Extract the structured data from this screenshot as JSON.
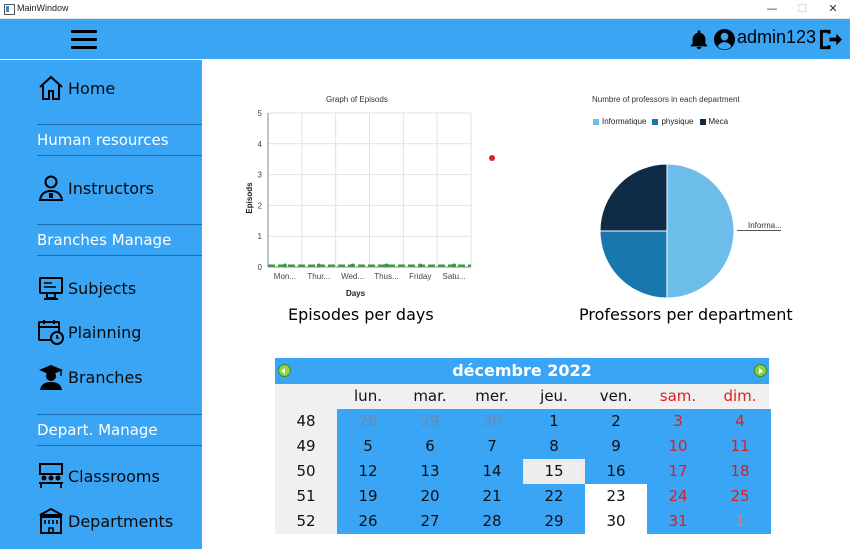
{
  "window": {
    "title": "MainWindow",
    "minimize": "—",
    "maximize": "☐",
    "close": "✕"
  },
  "header": {
    "username": "admin123"
  },
  "sidebar": {
    "home": "Home",
    "section_hr": "Human resources",
    "instructors": "Instructors",
    "section_branches": "Branches Manage",
    "subjects": "Subjects",
    "planning": "Plainning",
    "branches": "Branches",
    "section_depart": "Depart. Manage",
    "classrooms": "Classrooms",
    "departments": "Departments"
  },
  "episodes_caption": "Episodes per days",
  "professors_caption": "Professors per department",
  "chart_data": [
    {
      "type": "line",
      "title": "Graph of Episods",
      "xlabel": "Days",
      "ylabel": "Episods",
      "categories": [
        "Mon...",
        "Thur...",
        "Wed...",
        "Thus...",
        "Friday",
        "Satu..."
      ],
      "ylim": [
        0,
        5
      ],
      "yticks": [
        "0",
        "1",
        "2",
        "3",
        "4",
        "5"
      ],
      "series": [
        {
          "values": [
            0,
            0,
            0,
            0,
            0,
            0
          ],
          "color": "#2e9e3c"
        }
      ],
      "grid": true
    },
    {
      "type": "pie",
      "title": "Numbre of professors in each department",
      "legend": [
        "Informatique",
        "physique",
        "Meca"
      ],
      "legend_position": "top",
      "slices": [
        {
          "label": "Informatique",
          "value": 50,
          "color": "#6cbde9"
        },
        {
          "label": "physique",
          "value": 25,
          "color": "#1878ae"
        },
        {
          "label": "Meca",
          "value": 25,
          "color": "#0e2c45"
        }
      ],
      "slice_label": "Informa..."
    }
  ],
  "calendar": {
    "month": "décembre",
    "year": "2022",
    "dows": [
      "lun.",
      "mar.",
      "mer.",
      "jeu.",
      "ven.",
      "sam.",
      "dim."
    ],
    "weeks": [
      {
        "num": "48",
        "days": [
          "28",
          "29",
          "30",
          "1",
          "2",
          "3",
          "4"
        ]
      },
      {
        "num": "49",
        "days": [
          "5",
          "6",
          "7",
          "8",
          "9",
          "10",
          "11"
        ]
      },
      {
        "num": "50",
        "days": [
          "12",
          "13",
          "14",
          "15",
          "16",
          "17",
          "18"
        ]
      },
      {
        "num": "51",
        "days": [
          "19",
          "20",
          "21",
          "22",
          "23",
          "24",
          "25"
        ]
      },
      {
        "num": "52",
        "days": [
          "26",
          "27",
          "28",
          "29",
          "30",
          "31",
          "1"
        ]
      }
    ],
    "selected": "15"
  },
  "colors": {
    "accent": "#3aa5f5",
    "weekend": "#d92020"
  }
}
